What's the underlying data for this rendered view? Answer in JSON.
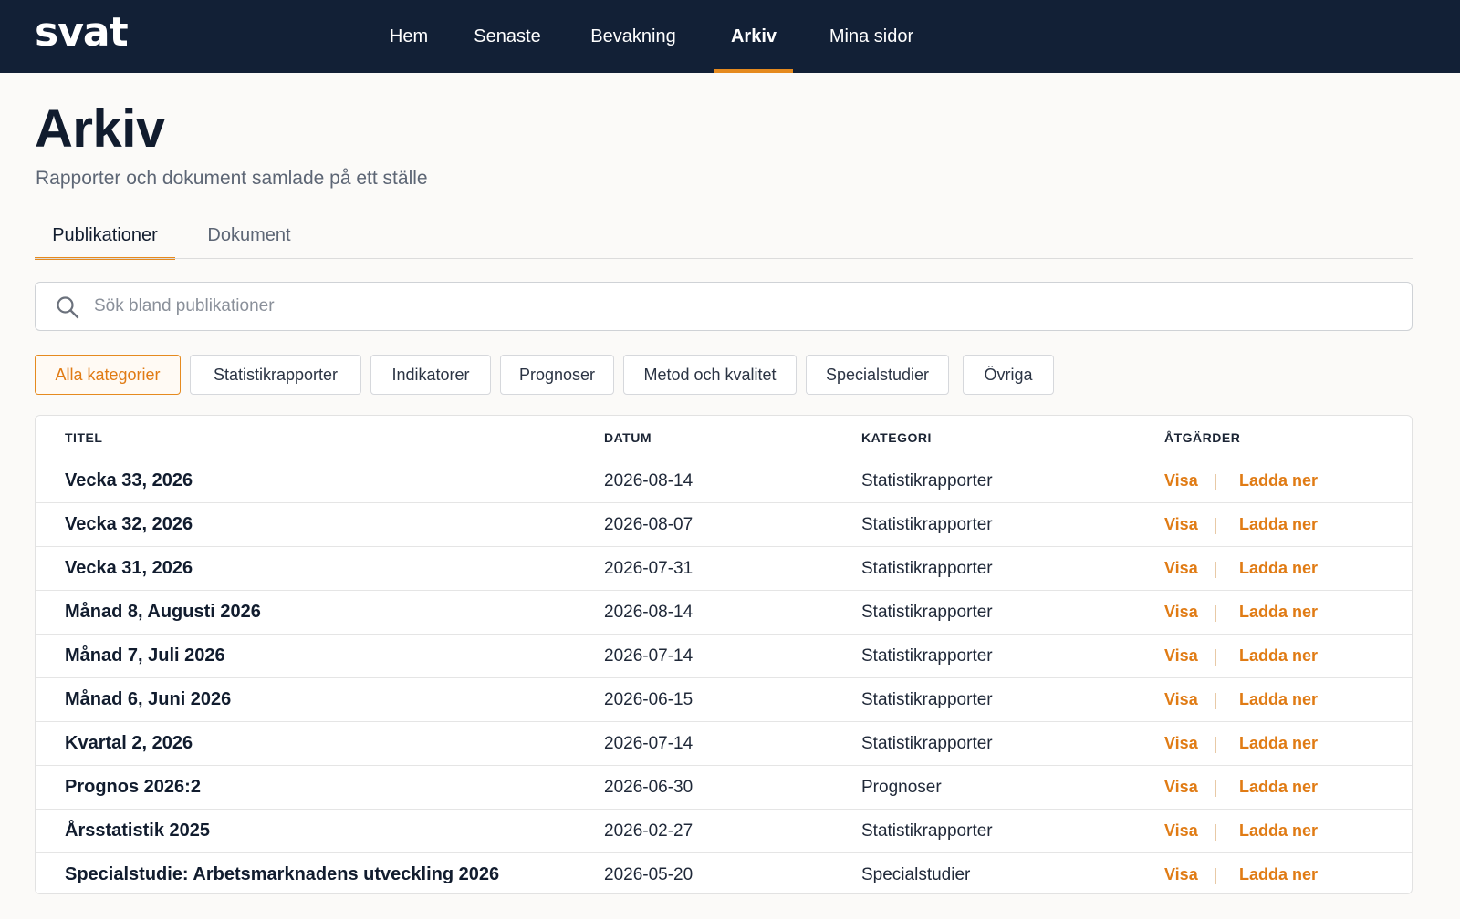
{
  "app": {
    "logo": "svat"
  },
  "nav": {
    "items": [
      {
        "label": "Hem"
      },
      {
        "label": "Senaste"
      },
      {
        "label": "Bevakning"
      },
      {
        "label": "Arkiv"
      },
      {
        "label": "Mina sidor"
      }
    ],
    "active_index": 3
  },
  "page": {
    "title": "Arkiv",
    "subtitle": "Rapporter och dokument samlade på ett ställe"
  },
  "tabs": [
    {
      "label": "Publikationer",
      "active": true
    },
    {
      "label": "Dokument",
      "active": false
    }
  ],
  "search": {
    "placeholder": "Sök bland publikationer",
    "value": ""
  },
  "filters": [
    {
      "label": "Alla kategorier",
      "active": true
    },
    {
      "label": "Statistikrapporter",
      "active": false
    },
    {
      "label": "Indikatorer",
      "active": false
    },
    {
      "label": "Prognoser",
      "active": false
    },
    {
      "label": "Metod och kvalitet",
      "active": false
    },
    {
      "label": "Specialstudier",
      "active": false
    },
    {
      "label": "Övriga",
      "active": false
    }
  ],
  "table": {
    "headers": {
      "title": "TITEL",
      "date": "DATUM",
      "category": "KATEGORI",
      "actions": "ÅTGÄRDER"
    },
    "rows": [
      {
        "title": "Vecka 33, 2026",
        "date": "2026-08-14",
        "category": "Statistikrapporter",
        "view": "Visa",
        "download": "Ladda ner"
      },
      {
        "title": "Vecka 32, 2026",
        "date": "2026-08-07",
        "category": "Statistikrapporter",
        "view": "Visa",
        "download": "Ladda ner"
      },
      {
        "title": "Vecka 31, 2026",
        "date": "2026-07-31",
        "category": "Statistikrapporter",
        "view": "Visa",
        "download": "Ladda ner"
      },
      {
        "title": "Månad 8, Augusti 2026",
        "date": "2026-08-14",
        "category": "Statistikrapporter",
        "view": "Visa",
        "download": "Ladda ner"
      },
      {
        "title": "Månad 7, Juli 2026",
        "date": "2026-07-14",
        "category": "Statistikrapporter",
        "view": "Visa",
        "download": "Ladda ner"
      },
      {
        "title": "Månad 6, Juni 2026",
        "date": "2026-06-15",
        "category": "Statistikrapporter",
        "view": "Visa",
        "download": "Ladda ner"
      },
      {
        "title": "Kvartal 2, 2026",
        "date": "2026-07-14",
        "category": "Statistikrapporter",
        "view": "Visa",
        "download": "Ladda ner"
      },
      {
        "title": "Prognos 2026:2",
        "date": "2026-06-30",
        "category": "Prognoser",
        "view": "Visa",
        "download": "Ladda ner"
      },
      {
        "title": "Årsstatistik 2025",
        "date": "2026-02-27",
        "category": "Statistikrapporter",
        "view": "Visa",
        "download": "Ladda ner"
      },
      {
        "title": "Specialstudie: Arbetsmarknadens utveckling 2026",
        "date": "2026-05-20",
        "category": "Specialstudier",
        "view": "Visa",
        "download": "Ladda ner"
      }
    ]
  },
  "colors": {
    "navbar": "#122036",
    "accent": "#e58a1f",
    "background": "#fbfaf8"
  },
  "icons": {
    "search": "search-icon"
  }
}
